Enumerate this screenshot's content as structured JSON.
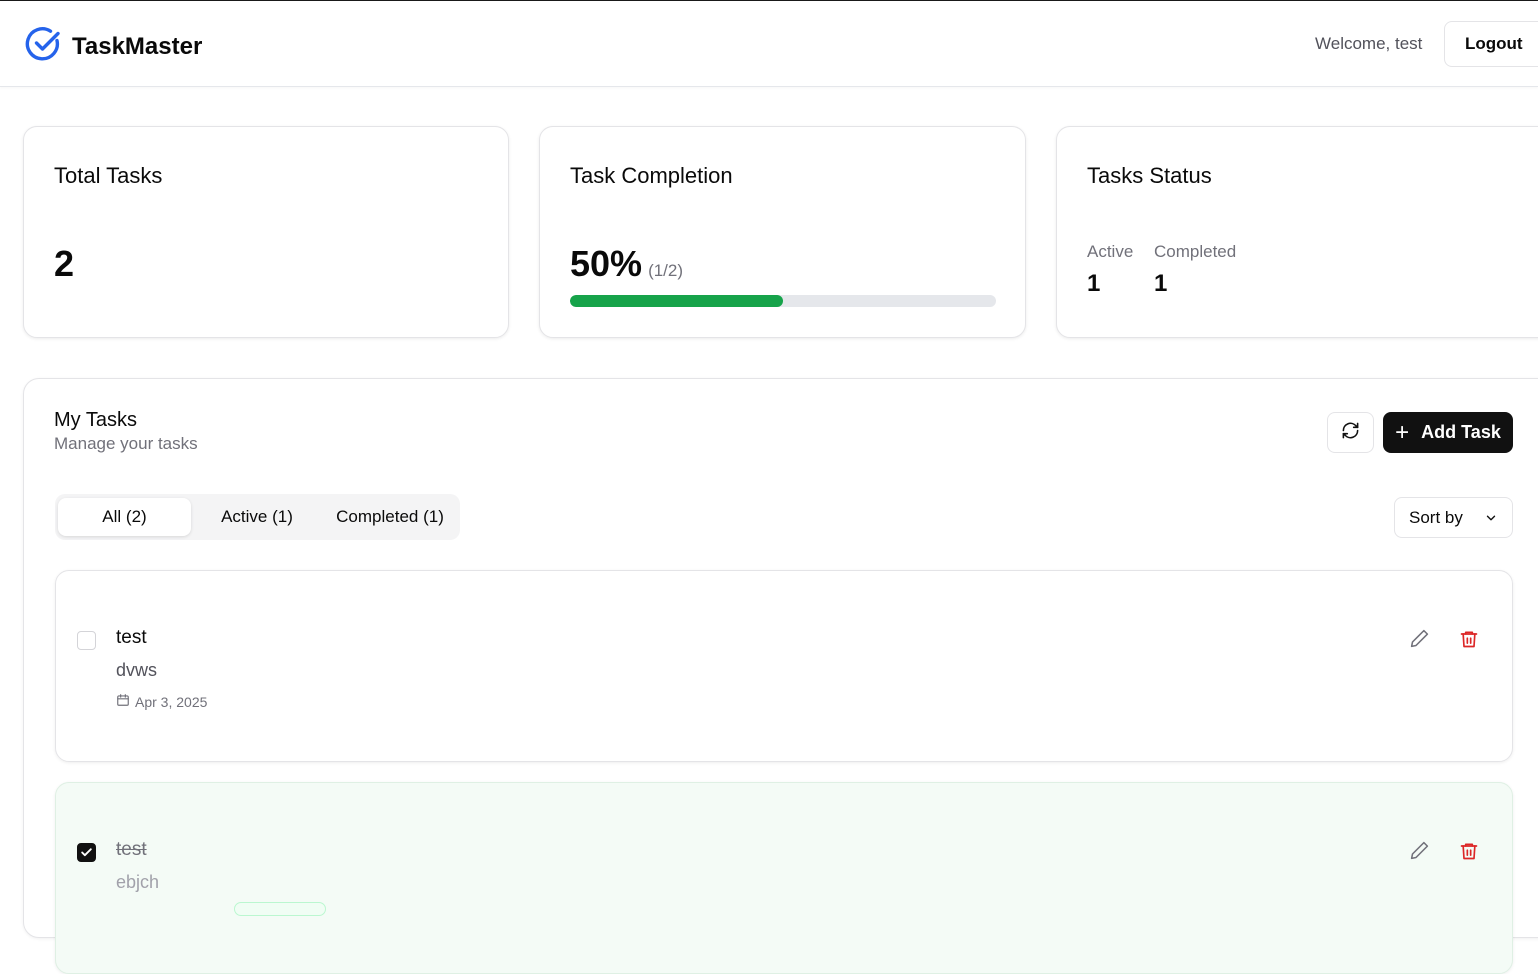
{
  "header": {
    "app_name": "TaskMaster",
    "welcome_text": "Welcome, test",
    "logout_label": "Logout",
    "logo_icon": "check-circle-icon",
    "brand_color": "#2563eb"
  },
  "stats": {
    "total": {
      "title": "Total Tasks",
      "value": "2"
    },
    "completion": {
      "title": "Task Completion",
      "percent_text": "50%",
      "fraction_text": "(1/2)",
      "progress_fraction": 0.5,
      "progress_color": "#16a34a"
    },
    "status": {
      "title": "Tasks Status",
      "active_label": "Active",
      "active_value": "1",
      "completed_label": "Completed",
      "completed_value": "1"
    }
  },
  "tasks_panel": {
    "title": "My Tasks",
    "subtitle": "Manage your tasks",
    "refresh_icon": "refresh-icon",
    "add_label": "Add Task",
    "add_icon": "plus-icon",
    "tabs": [
      {
        "label": "All (2)",
        "active": true
      },
      {
        "label": "Active (1)",
        "active": false
      },
      {
        "label": "Completed (1)",
        "active": false
      }
    ],
    "sort_label": "Sort by",
    "tasks": [
      {
        "title": "test",
        "description": "dvws",
        "date": "Apr 3, 2025",
        "completed": false
      },
      {
        "title": "test",
        "description": "ebjch",
        "completed": true
      }
    ],
    "edit_icon": "pencil-icon",
    "delete_icon": "trash-icon",
    "delete_color": "#dc2626"
  }
}
